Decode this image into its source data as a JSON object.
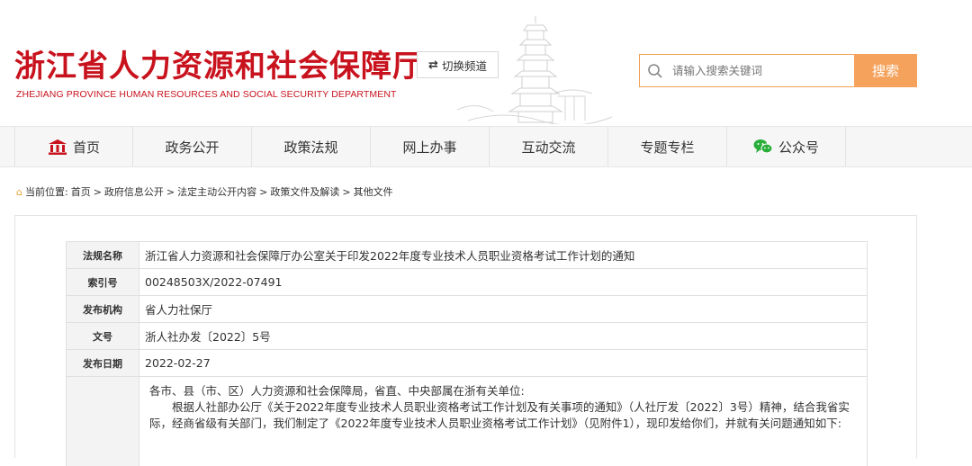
{
  "header": {
    "title_cn": "浙江省人力资源和社会保障厅",
    "title_en": "ZHEJIANG PROVINCE HUMAN RESOURCES AND SOCIAL SECURITY DEPARTMENT",
    "switch_label": "切换频道",
    "search_placeholder": "请输入搜索关键词",
    "search_button": "搜索",
    "brand_color": "#c8121d"
  },
  "nav": {
    "items": [
      {
        "label": "首页",
        "icon": "home-icon"
      },
      {
        "label": "政务公开"
      },
      {
        "label": "政策法规"
      },
      {
        "label": "网上办事"
      },
      {
        "label": "互动交流"
      },
      {
        "label": "专题专栏"
      },
      {
        "label": "公众号",
        "icon": "wechat-icon"
      }
    ]
  },
  "breadcrumb": {
    "prefix": "当前位置:",
    "items": [
      "首页",
      "政府信息公开",
      "法定主动公开内容",
      "政策文件及解读",
      "其他文件"
    ],
    "separator": ">"
  },
  "meta": {
    "rows": [
      {
        "label": "法规名称",
        "value": "浙江省人力资源和社会保障厅办公室关于印发2022年度专业技术人员职业资格考试工作计划的通知"
      },
      {
        "label": "索引号",
        "value": "00248503X/2022-07491"
      },
      {
        "label": "发布机构",
        "value": "省人力社保厅"
      },
      {
        "label": "文号",
        "value": "浙人社办发〔2022〕5号"
      },
      {
        "label": "发布日期",
        "value": "2022-02-27"
      }
    ]
  },
  "body": {
    "salutation": "各市、县（市、区）人力资源和社会保障局，省直、中央部属在浙有关单位:",
    "paragraph": "根据人社部办公厅《关于2022年度专业技术人员职业资格考试工作计划及有关事项的通知》（人社厅发〔2022〕3号）精神，结合我省实际，经商省级有关部门，我们制定了《2022年度专业技术人员职业资格考试工作计划》（见附件1），现印发给你们，并就有关问题通知如下:"
  }
}
